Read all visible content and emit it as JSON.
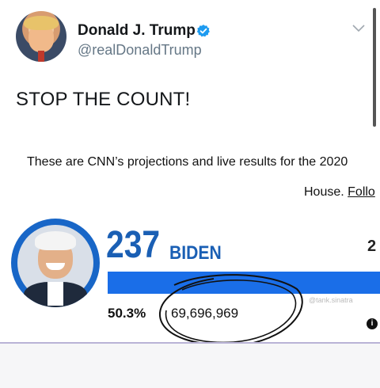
{
  "tweet": {
    "display_name": "Donald J. Trump",
    "handle": "@realDonaldTrump",
    "text": "STOP THE COUNT!",
    "verified": true
  },
  "article": {
    "line1": "These are CNN’s projections and live results for the 2020",
    "line2_prefix": "House. ",
    "line2_link": "Follo"
  },
  "election": {
    "electoral_votes": "237",
    "candidate": "BIDEN",
    "opponent_votes_partial": "2",
    "vote_percent": "50.3%",
    "vote_count": "69,696,969",
    "progress_fraction": 1.0,
    "watermark": "@tank.sinatra",
    "info_symbol": "i"
  },
  "colors": {
    "biden_blue": "#1a5fb4",
    "bar_blue": "#1a6ee8",
    "verified_blue": "#1d9bf0"
  },
  "icons": {
    "verified": "verified-badge-icon",
    "chevron": "chevron-down-icon",
    "info": "info-icon"
  }
}
